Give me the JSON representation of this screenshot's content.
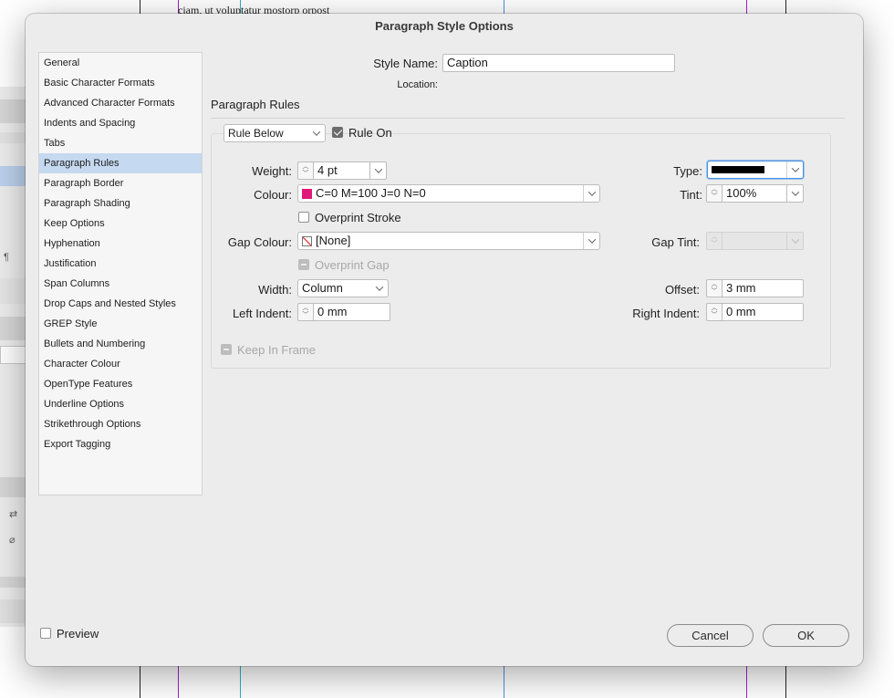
{
  "background": {
    "doc_text": "ciam, ut voluptatur mostorp orpost"
  },
  "dialog": {
    "title": "Paragraph Style Options",
    "style_name_label": "Style Name:",
    "style_name_value": "Caption",
    "location_label": "Location:",
    "section_title": "Paragraph Rules",
    "sidebar": [
      {
        "label": "General",
        "active": false
      },
      {
        "label": "Basic Character Formats",
        "active": false
      },
      {
        "label": "Advanced Character Formats",
        "active": false
      },
      {
        "label": "Indents and Spacing",
        "active": false
      },
      {
        "label": "Tabs",
        "active": false
      },
      {
        "label": "Paragraph Rules",
        "active": true
      },
      {
        "label": "Paragraph Border",
        "active": false
      },
      {
        "label": "Paragraph Shading",
        "active": false
      },
      {
        "label": "Keep Options",
        "active": false
      },
      {
        "label": "Hyphenation",
        "active": false
      },
      {
        "label": "Justification",
        "active": false
      },
      {
        "label": "Span Columns",
        "active": false
      },
      {
        "label": "Drop Caps and Nested Styles",
        "active": false
      },
      {
        "label": "GREP Style",
        "active": false
      },
      {
        "label": "Bullets and Numbering",
        "active": false
      },
      {
        "label": "Character Colour",
        "active": false
      },
      {
        "label": "OpenType Features",
        "active": false
      },
      {
        "label": "Underline Options",
        "active": false
      },
      {
        "label": "Strikethrough Options",
        "active": false
      },
      {
        "label": "Export Tagging",
        "active": false
      }
    ],
    "rule_select": "Rule Below",
    "rule_on_label": "Rule On",
    "weight_label": "Weight:",
    "weight_value": "4 pt",
    "type_label": "Type:",
    "colour_label": "Colour:",
    "colour_value": "C=0 M=100 J=0 N=0",
    "colour_swatch": "#e0187a",
    "tint_label": "Tint:",
    "tint_value": "100%",
    "overprint_stroke_label": "Overprint Stroke",
    "gap_colour_label": "Gap Colour:",
    "gap_colour_value": "[None]",
    "gap_tint_label": "Gap Tint:",
    "overprint_gap_label": "Overprint Gap",
    "width_label": "Width:",
    "width_value": "Column",
    "offset_label": "Offset:",
    "offset_value": "3 mm",
    "left_indent_label": "Left Indent:",
    "left_indent_value": "0 mm",
    "right_indent_label": "Right Indent:",
    "right_indent_value": "0 mm",
    "keep_in_frame_label": "Keep In Frame",
    "preview_label": "Preview",
    "cancel_label": "Cancel",
    "ok_label": "OK"
  }
}
